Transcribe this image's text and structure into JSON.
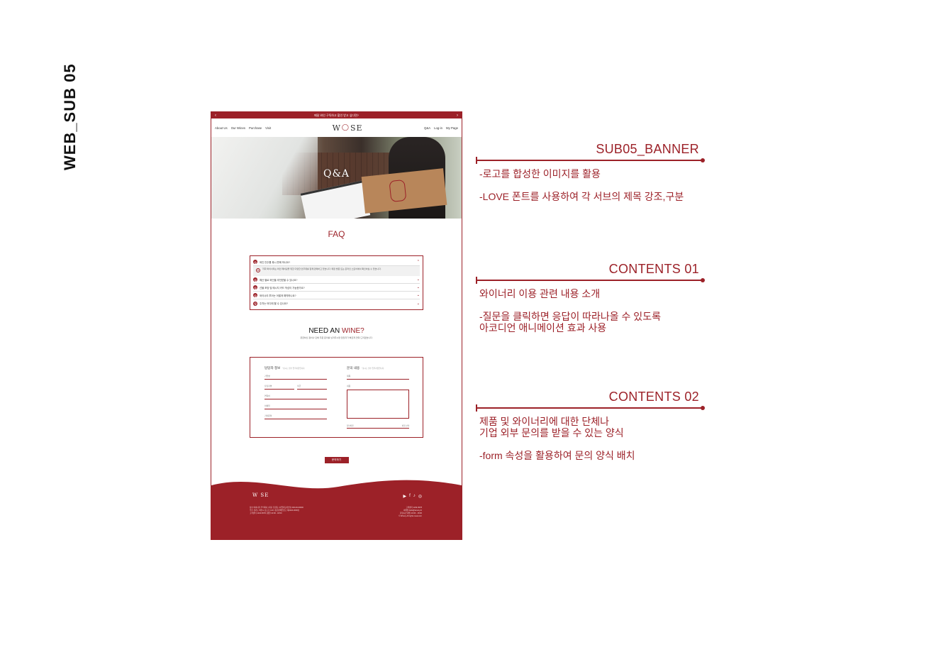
{
  "side_title": "WEB_SUB 05",
  "mockup": {
    "topbar_text": "매달 와인 구독하고 할인 받고 싶다면?",
    "nav_left": [
      "About Us",
      "Our Wines",
      "Purchase",
      "Visit"
    ],
    "logo": {
      "left": "W",
      "right": "SE"
    },
    "nav_right": [
      "Q&A",
      "Log-in",
      "My Page"
    ],
    "banner_title": "Q&A",
    "faq_title": "FAQ",
    "faq_items": [
      "와인 안주를 혹시 판매 하나요?",
      "예산 별로 와인을 추천받을 수 있나요?",
      "선물 포장 및 메시지 카드 작성이 가능한가요?",
      "와이너리 투어는 어떻게 예약하나요?",
      "주차는 어디에 할 수 있나요?"
    ],
    "faq_answer": "저희 와이너리는 와인 페어링을 위한 다양한 안주류를 함께 판매하고 있습니다. 매장 방문 또는 온라인 스토어에서 확인하실 수 있습니다.",
    "need_prefix": "NEED AN ",
    "need_accent": "WINE?",
    "need_sub": "궁금하신 점이나 단체 주문 문의를 남겨주시면 담당자가 빠르게 연락 드리겠습니다.",
    "form": {
      "left_head": "담당자 정보",
      "left_note": "*표시는 필수 입력사항입니다.",
      "right_head": "문의 내용",
      "right_note": "*표시는 필수 입력사항입니다.",
      "fields_left": [
        "기업명",
        "담당자명",
        "직급",
        "연락처",
        "이메일",
        "기타문의"
      ],
      "fields_right": [
        "제목",
        "내용"
      ],
      "attach_label": "첨부파일",
      "attach_button": "파일 선택"
    },
    "submit": "문의하기",
    "footer": {
      "logo": "W SE",
      "social": [
        "▶",
        "f",
        "♪",
        "◎"
      ],
      "info_left": "상호 와이너리 주식회사 | 대표 홍길동 | 사업자등록번호 000-00-00000\n주소 경기도 와인시 포도로 123 | 통신판매업신고 제2024-0000호\n고객센터 1234-5678 | 평일 10:00 - 18:00",
      "info_right": "고객센터 1234-5678\n이메일 hello@winery.kr\n운영시간 평일 10:00 - 18:00\n© Winery All rights reserved."
    }
  },
  "annotations": [
    {
      "head": "SUB05_BANNER",
      "desc": "-로고를 합성한 이미지를 활용\n\n-LOVE 폰트를 사용하여 각 서브의 제목 강조,구분"
    },
    {
      "head": "CONTENTS 01",
      "desc": "와이너리 이용 관련 내용 소개\n\n-질문을 클릭하면 응답이 따라나올 수 있도록\n  아코디언 애니메이션 효과 사용"
    },
    {
      "head": "CONTENTS 02",
      "desc": "제품 및 와이너리에 대한 단체나\n기업 외부 문의를 받을 수 있는 양식\n\n-form 속성을 활용하여 문의 양식 배치"
    }
  ],
  "colors": {
    "accent": "#9c2128"
  }
}
